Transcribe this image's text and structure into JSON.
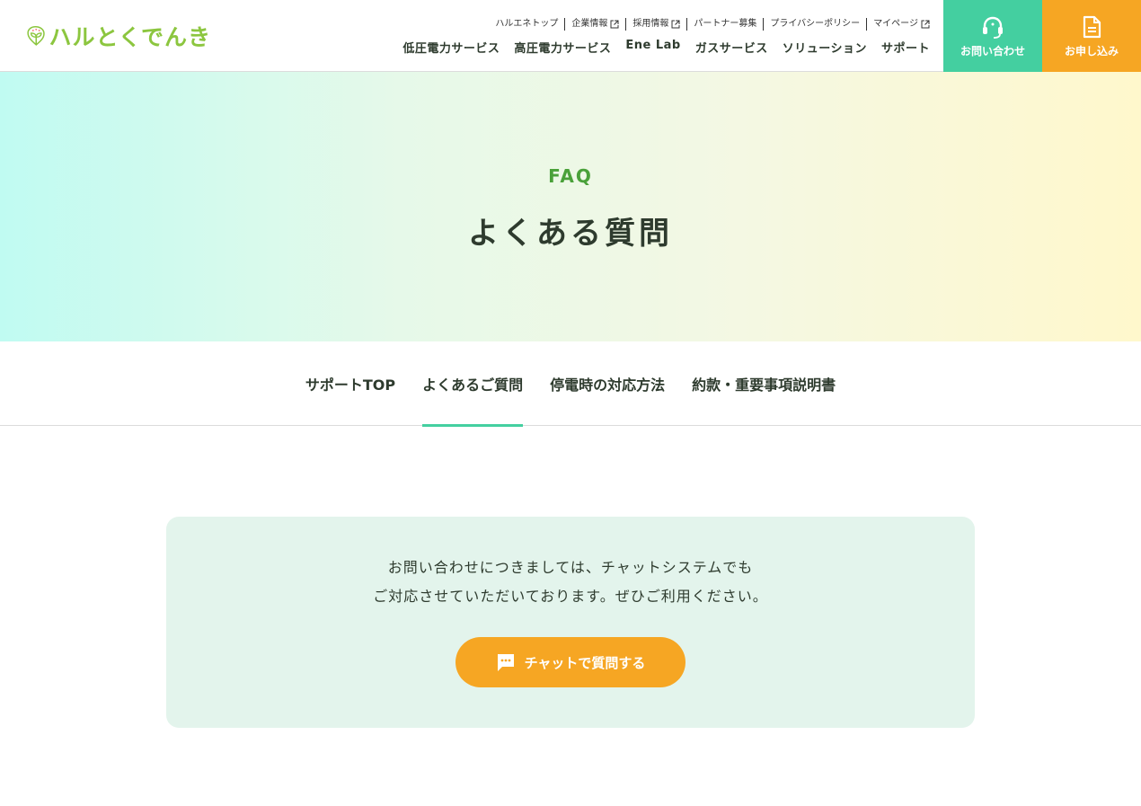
{
  "header": {
    "logo_text": "ハルとくでんき",
    "util_nav": [
      {
        "label": "ハルエネトップ",
        "external": false
      },
      {
        "label": "企業情報",
        "external": true
      },
      {
        "label": "採用情報",
        "external": true
      },
      {
        "label": "パートナー募集",
        "external": false
      },
      {
        "label": "プライバシーポリシー",
        "external": false
      },
      {
        "label": "マイページ",
        "external": true
      }
    ],
    "main_nav": [
      "低圧電力サービス",
      "高圧電力サービス",
      "Ene Lab",
      "ガスサービス",
      "ソリューション",
      "サポート"
    ],
    "contact_label": "お問い合わせ",
    "apply_label": "お申し込み",
    "colors": {
      "contact": "#44cfa0",
      "apply": "#f6a623",
      "logo": "#8cc63f"
    }
  },
  "hero": {
    "title_en": "FAQ",
    "title_jp": "よくある質問"
  },
  "subnav": {
    "items": [
      "サポートTOP",
      "よくあるご質問",
      "停電時の対応方法",
      "約款・重要事項説明書"
    ],
    "active_index": 1
  },
  "info": {
    "line1": "お問い合わせにつきましては、チャットシステムでも",
    "line2": "ご対応させていただいております。ぜひご利用ください。",
    "chat_button_label": "チャットで質問する"
  }
}
